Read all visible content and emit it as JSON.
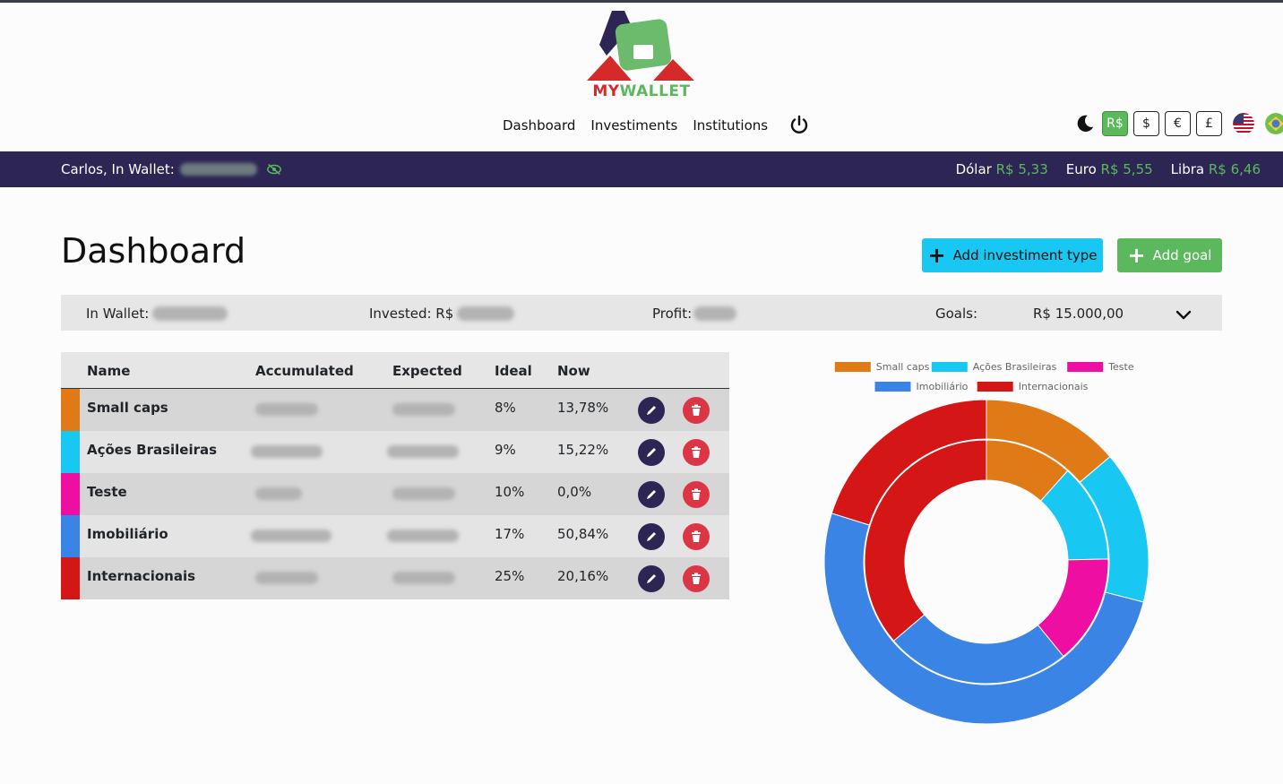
{
  "brand": {
    "my": "MY",
    "wallet": "WALLET"
  },
  "nav": {
    "dashboard": "Dashboard",
    "investiments": "Investiments",
    "institutions": "Institutions"
  },
  "currency": {
    "brl": "R$",
    "usd": "$",
    "eur": "€",
    "gbp": "£",
    "active": "R$"
  },
  "infobar": {
    "greeting": "Carlos, In Wallet:",
    "rates": [
      {
        "label": "Dólar",
        "value": "R$ 5,33"
      },
      {
        "label": "Euro",
        "value": "R$ 5,55"
      },
      {
        "label": "Libra",
        "value": "R$ 6,46"
      }
    ]
  },
  "page": {
    "title": "Dashboard",
    "add_type": "Add investiment type",
    "add_goal": "Add goal"
  },
  "summary": {
    "in_wallet": "In Wallet:",
    "invested": "Invested: R$",
    "profit": "Profit:",
    "goals": "Goals:",
    "goals_value": "R$ 15.000,00"
  },
  "table": {
    "headers": {
      "name": "Name",
      "accumulated": "Accumulated",
      "expected": "Expected",
      "ideal": "Ideal",
      "now": "Now"
    },
    "rows": [
      {
        "name": "Small caps",
        "ideal": "8%",
        "now": "13,78%",
        "color": "#e07a16"
      },
      {
        "name": "Ações Brasileiras",
        "ideal": "9%",
        "now": "15,22%",
        "color": "#19c8f2"
      },
      {
        "name": "Teste",
        "ideal": "10%",
        "now": "0,0%",
        "color": "#ee0fa2"
      },
      {
        "name": "Imobiliário",
        "ideal": "17%",
        "now": "50,84%",
        "color": "#3a84e6"
      },
      {
        "name": "Internacionais",
        "ideal": "25%",
        "now": "20,16%",
        "color": "#d51616"
      }
    ]
  },
  "chart_data": {
    "type": "pie",
    "legend_position": "top",
    "categories": [
      "Small caps",
      "Ações Brasileiras",
      "Teste",
      "Imobiliário",
      "Internacionais"
    ],
    "colors": [
      "#e07a16",
      "#19c8f2",
      "#ee0fa2",
      "#3a84e6",
      "#d51616"
    ],
    "series": [
      {
        "values": [
          13.78,
          15.22,
          0,
          50.84,
          20.16
        ]
      },
      {
        "values": [
          8,
          9,
          10,
          17,
          25
        ]
      }
    ]
  }
}
